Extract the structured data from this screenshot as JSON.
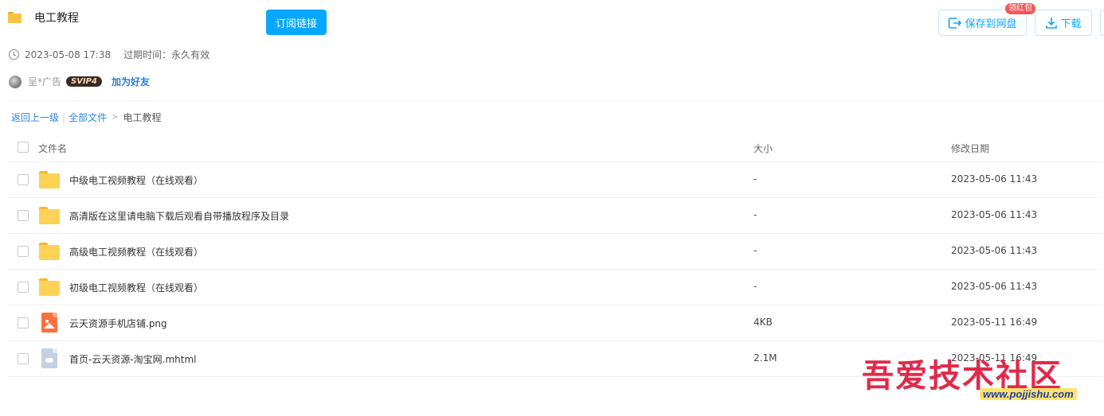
{
  "header": {
    "title": "电工教程",
    "subscribe_label": "订阅链接",
    "save_label": "保存到网盘",
    "save_badge": "领红包",
    "download_label": "下载"
  },
  "meta": {
    "created": "2023-05-08 17:38",
    "expire_label": "过期时间：",
    "expire_value": "永久有效"
  },
  "user": {
    "name": "呈*广告",
    "badge": "SVIP4",
    "add_friend": "加为好友"
  },
  "breadcrumb": {
    "back": "返回上一级",
    "pipe": "|",
    "all_files": "全部文件",
    "arrow": ">",
    "current": "电工教程"
  },
  "columns": {
    "name": "文件名",
    "size": "大小",
    "date": "修改日期"
  },
  "files": [
    {
      "name": "中级电工视频教程（在线观看）",
      "size": "-",
      "date": "2023-05-06 11:43",
      "icon": "folder-icon"
    },
    {
      "name": "高清版在这里请电脑下载后观看自带播放程序及目录",
      "size": "-",
      "date": "2023-05-06 11:43",
      "icon": "folder-icon"
    },
    {
      "name": "高级电工视频教程（在线观看）",
      "size": "-",
      "date": "2023-05-06 11:43",
      "icon": "folder-icon"
    },
    {
      "name": "初级电工视频教程（在线观看）",
      "size": "-",
      "date": "2023-05-06 11:43",
      "icon": "folder-icon"
    },
    {
      "name": "云天资源手机店铺.png",
      "size": "4KB",
      "date": "2023-05-11 16:49",
      "icon": "image-file-icon"
    },
    {
      "name": "首页-云天资源-淘宝网.mhtml",
      "size": "2.1M",
      "date": "2023-05-11 16:49",
      "icon": "other-file-icon"
    }
  ],
  "watermark": {
    "text": "吾爱技术社区",
    "url": "www.pojjishu.com"
  },
  "colors": {
    "accent": "#06a7ff",
    "link": "#2c86d8",
    "folder": "#fdd255",
    "badge_red": "#f25858"
  }
}
